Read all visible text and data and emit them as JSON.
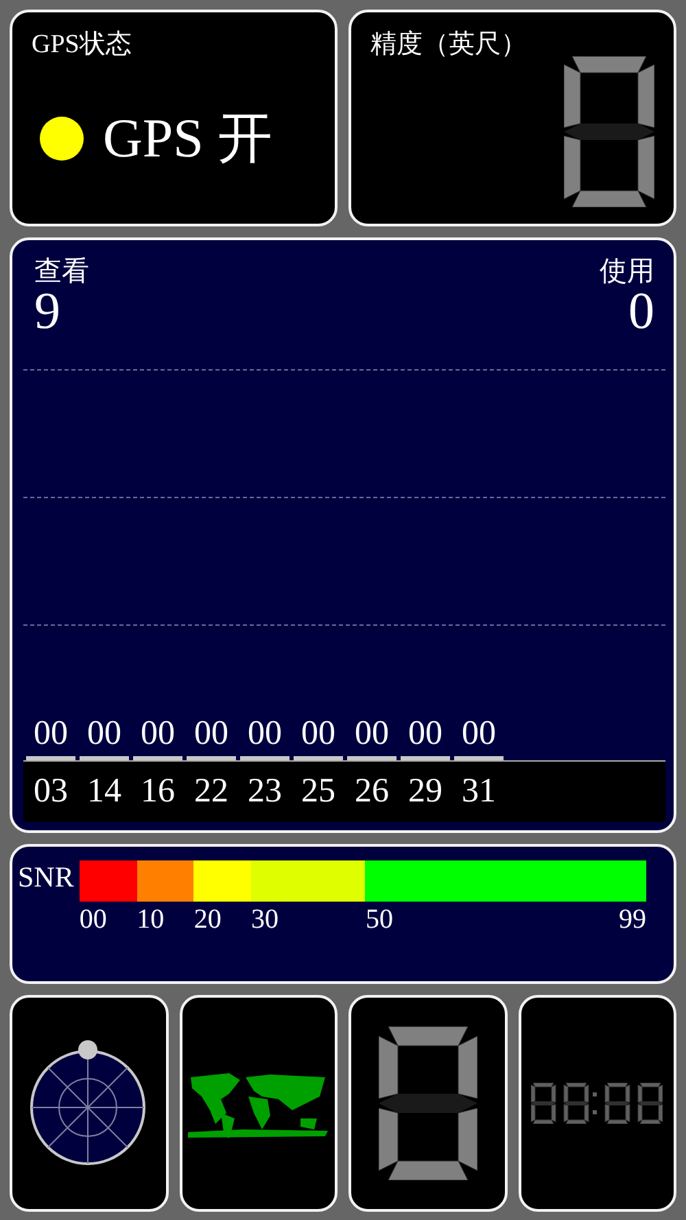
{
  "gps_status": {
    "title": "GPS状态",
    "color": "#ffff00",
    "value": "GPS 开"
  },
  "accuracy": {
    "title": "精度（英尺）"
  },
  "satellites": {
    "viewed_label": "查看",
    "viewed": "9",
    "used_label": "使用",
    "used": "0",
    "items": [
      {
        "snr": "00",
        "prn": "03"
      },
      {
        "snr": "00",
        "prn": "14"
      },
      {
        "snr": "00",
        "prn": "16"
      },
      {
        "snr": "00",
        "prn": "22"
      },
      {
        "snr": "00",
        "prn": "23"
      },
      {
        "snr": "00",
        "prn": "25"
      },
      {
        "snr": "00",
        "prn": "26"
      },
      {
        "snr": "00",
        "prn": "29"
      },
      {
        "snr": "00",
        "prn": "31"
      }
    ]
  },
  "snr_scale": {
    "label": "SNR",
    "bands": [
      {
        "color": "#ff0000"
      },
      {
        "color": "#ff8000"
      },
      {
        "color": "#ffff00"
      },
      {
        "color": "#dfff00"
      },
      {
        "color": "#00ff00"
      }
    ],
    "ticks": [
      "00",
      "10",
      "20",
      "30",
      "50",
      "99"
    ]
  },
  "bottom_buttons": [
    {
      "kind": "radar"
    },
    {
      "kind": "map"
    },
    {
      "kind": "digit"
    },
    {
      "kind": "clock"
    }
  ]
}
